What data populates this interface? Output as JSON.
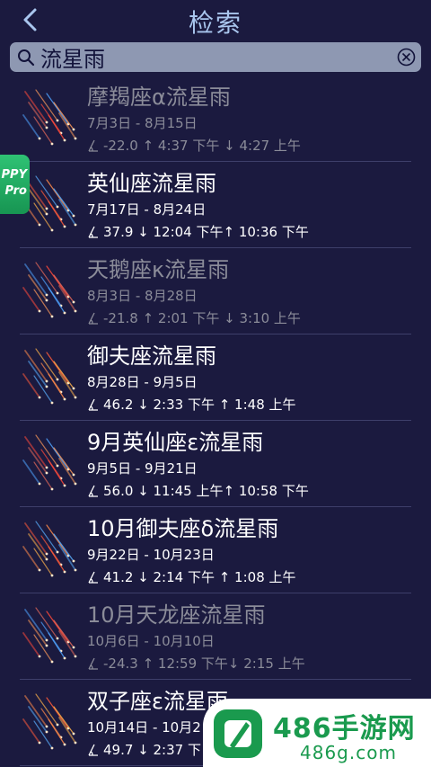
{
  "header": {
    "title": "检索"
  },
  "search": {
    "value": "流星雨",
    "placeholder": ""
  },
  "float_badge": {
    "line1": "PPY",
    "line2": "Pro"
  },
  "showers": [
    {
      "name": "摩羯座α流星雨",
      "dates": "7月3日 - 8月15日",
      "stats": "-22.0 ↑ 4:37 下午 ↓ 4:27 上午",
      "dimmed": true
    },
    {
      "name": "英仙座流星雨",
      "dates": "7月17日 - 8月24日",
      "stats": "37.9 ↓ 12:04 下午↑ 10:36 下午",
      "dimmed": false
    },
    {
      "name": "天鹅座κ流星雨",
      "dates": "8月3日 - 8月28日",
      "stats": "-21.8 ↑ 2:01 下午 ↓ 3:10 上午",
      "dimmed": true
    },
    {
      "name": "御夫座流星雨",
      "dates": "8月28日 - 9月5日",
      "stats": "46.2 ↓ 2:33 下午 ↑ 1:48 上午",
      "dimmed": false
    },
    {
      "name": "9月英仙座ε流星雨",
      "dates": "9月5日 - 9月21日",
      "stats": "56.0 ↓ 11:45 上午↑ 10:58 下午",
      "dimmed": false
    },
    {
      "name": "10月御夫座δ流星雨",
      "dates": "9月22日 - 10月23日",
      "stats": "41.2 ↓ 2:14 下午 ↑ 1:08 上午",
      "dimmed": false
    },
    {
      "name": "10月天龙座流星雨",
      "dates": "10月6日 - 10月10日",
      "stats": "-24.3 ↑ 12:59 下午↓ 2:15 上午",
      "dimmed": true
    },
    {
      "name": "双子座ε流星雨",
      "dates": "10月14日 - 10月2",
      "stats": "49.7 ↓ 2:37 下",
      "dimmed": false
    }
  ],
  "watermark": {
    "title": "486手游网",
    "subtitle": "486g.com"
  },
  "colors": {
    "background": "#1b1a3f",
    "title": "#a9c6ee",
    "search_bg": "#8e98b2",
    "dimmed_text": "#8b8c99",
    "watermark_green": "#1a9a4e"
  }
}
